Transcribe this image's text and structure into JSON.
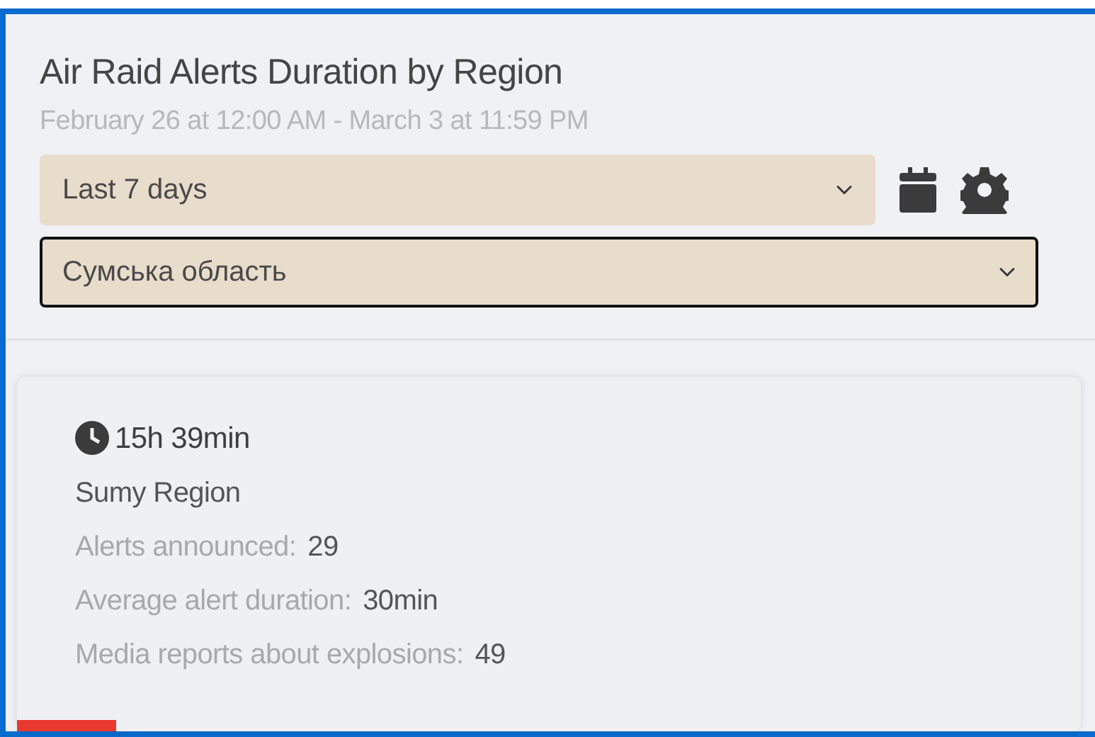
{
  "widget": {
    "title": "Air Raid Alerts Duration by Region",
    "date_range": "February 26 at 12:00 AM - March 3 at 11:59 PM",
    "selects": [
      {
        "value": "Last 7 days",
        "focused": false
      },
      {
        "value": "Сумська область",
        "focused": true
      }
    ]
  },
  "card": {
    "duration": "15h 39min",
    "region": "Sumy Region",
    "stats": [
      {
        "label": "Alerts announced:",
        "value": "29"
      },
      {
        "label": "Average alert duration:",
        "value": "30min"
      },
      {
        "label": "Media reports about explosions:",
        "value": "49"
      }
    ]
  }
}
